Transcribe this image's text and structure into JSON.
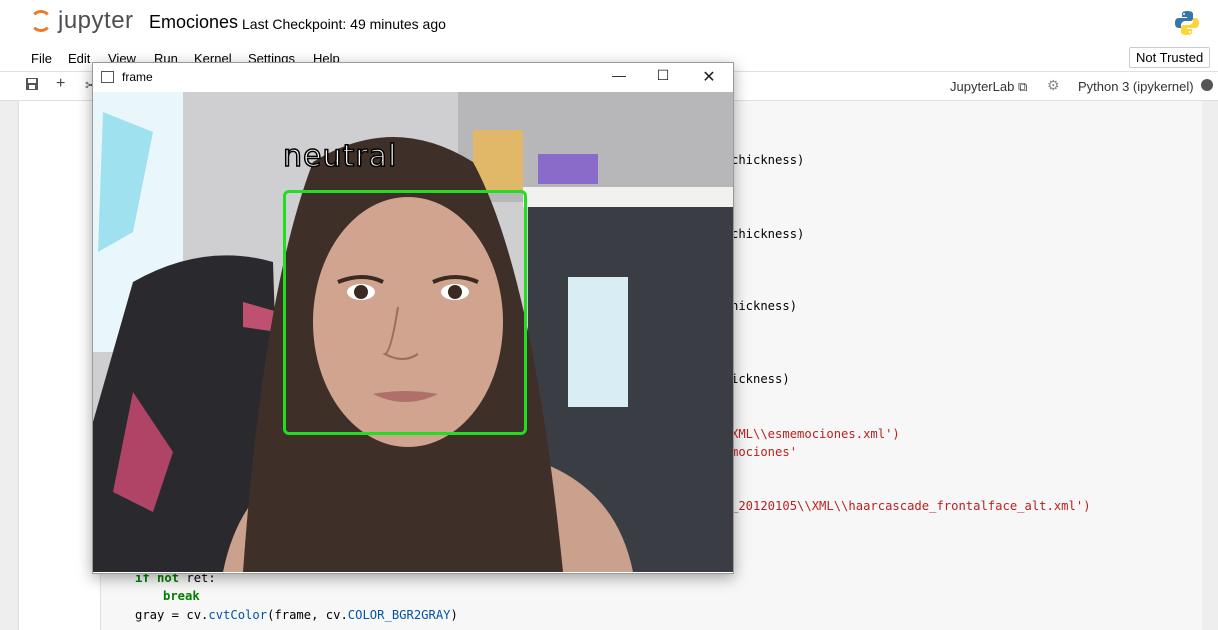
{
  "header": {
    "logo_text": "jupyter",
    "notebook_name": "Emociones",
    "checkpoint": "Last Checkpoint: 49 minutes ago"
  },
  "menu": {
    "items": [
      "File",
      "Edit",
      "View",
      "Run",
      "Kernel",
      "Settings",
      "Help"
    ],
    "trust_status": "Not Trusted"
  },
  "toolbar": {
    "icons": [
      "save-icon",
      "add-cell-icon",
      "cut-icon"
    ],
    "jupyterlab_link": "JupyterLab",
    "kernel_name": "Python 3 (ipykernel)"
  },
  "code_fragments": [
    "chickness)",
    "chickness)",
    "hickness)",
    "ickness)",
    "XML\\\\esmemociones.xml')",
    "mociones'",
    "_20120105\\\\XML\\\\haarcascade_frontalface_alt.xml')"
  ],
  "code_lines": {
    "line1_kw1": "if",
    "line1_kw2": "not",
    "line1_rest": " ret:",
    "line2": "break",
    "line3_a": "gray = cv.",
    "line3_b": "cvtColor",
    "line3_c": "(frame, cv.",
    "line3_d": "COLOR_BGR2GRAY",
    "line3_e": ")"
  },
  "frame_window": {
    "title": "frame",
    "controls": [
      "minimize-icon",
      "maximize-icon",
      "close-icon"
    ],
    "emotion_label": "neutral",
    "face_box_color": "#22dd22"
  },
  "colors": {
    "jupyter_orange": "#f37726",
    "string_red": "#ba2121",
    "keyword_green": "#008000"
  }
}
